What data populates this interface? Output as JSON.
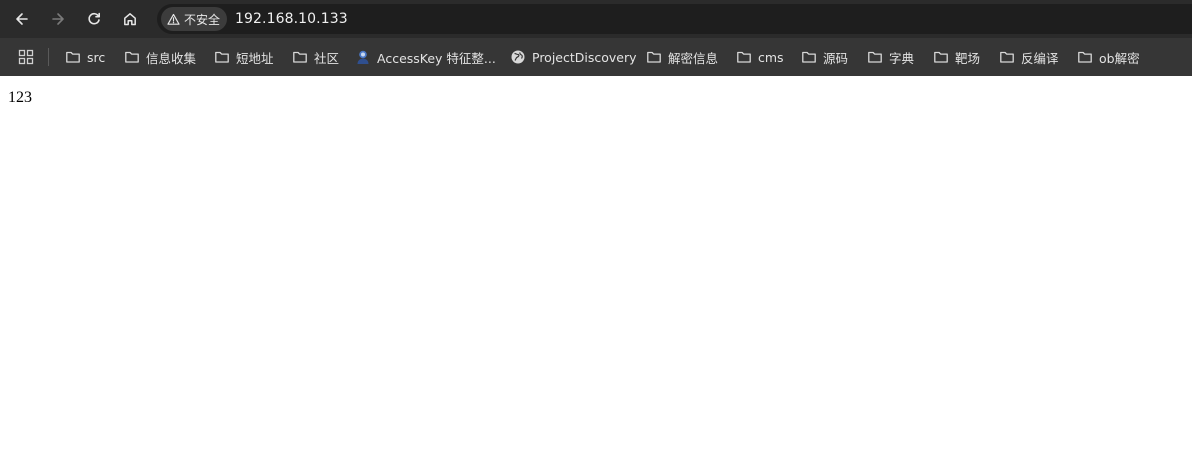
{
  "browser": {
    "security_label": "不安全",
    "url": "192.168.10.133",
    "icons": {
      "back": "arrow-left-icon",
      "forward": "arrow-right-icon",
      "reload": "reload-icon",
      "home": "home-icon",
      "security": "warning-triangle-icon",
      "apps": "apps-grid-icon"
    }
  },
  "bookmarks": [
    {
      "label": "src",
      "icon": "folder-icon"
    },
    {
      "label": "信息收集",
      "icon": "folder-icon"
    },
    {
      "label": "短地址",
      "icon": "folder-icon"
    },
    {
      "label": "社区",
      "icon": "folder-icon"
    },
    {
      "label": "AccessKey 特征整...",
      "icon": "avatar-favicon-icon"
    },
    {
      "label": "ProjectDiscovery",
      "icon": "globe-icon"
    },
    {
      "label": "解密信息",
      "icon": "folder-icon"
    },
    {
      "label": "cms",
      "icon": "folder-icon"
    },
    {
      "label": "源码",
      "icon": "folder-icon"
    },
    {
      "label": "字典",
      "icon": "folder-icon"
    },
    {
      "label": "靶场",
      "icon": "folder-icon"
    },
    {
      "label": "反编译",
      "icon": "folder-icon"
    },
    {
      "label": "ob解密",
      "icon": "folder-icon"
    }
  ],
  "page": {
    "body_text": "123"
  }
}
